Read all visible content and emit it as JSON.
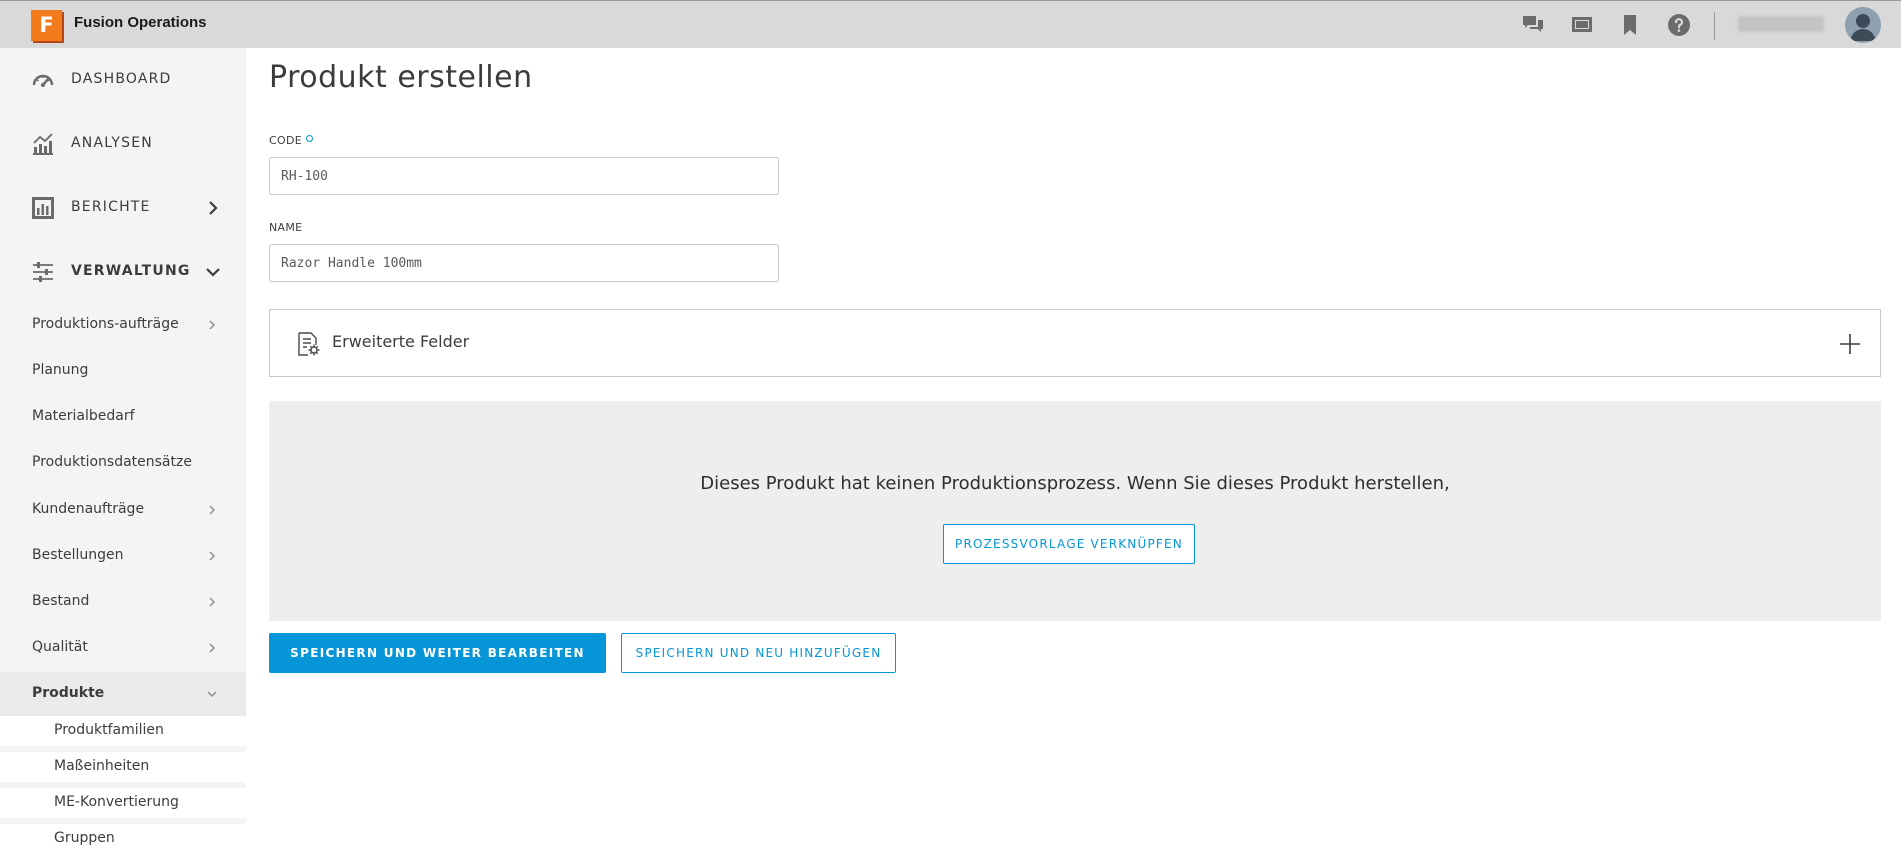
{
  "app": {
    "logo_letter": "F",
    "title": "Fusion Operations"
  },
  "topbar_icons": [
    "chat-icon",
    "screen-icon",
    "bookmark-icon",
    "help-icon"
  ],
  "sidebar": {
    "main": [
      {
        "label": "DASHBOARD",
        "icon": "dashboard-gauge-icon"
      },
      {
        "label": "ANALYSEN",
        "icon": "analytics-chart-icon"
      },
      {
        "label": "BERICHTE",
        "icon": "reports-bar-icon",
        "chevron": "right"
      },
      {
        "label": "VERWALTUNG",
        "icon": "settings-sliders-icon",
        "chevron": "down"
      }
    ],
    "sub": [
      {
        "label": "Produktions-aufträge",
        "chevron": true
      },
      {
        "label": "Planung",
        "chevron": false
      },
      {
        "label": "Materialbedarf",
        "chevron": false
      },
      {
        "label": "Produktionsdatensätze",
        "chevron": false
      },
      {
        "label": "Kundenaufträge",
        "chevron": true
      },
      {
        "label": "Bestellungen",
        "chevron": true
      },
      {
        "label": "Bestand",
        "chevron": true
      },
      {
        "label": "Qualität",
        "chevron": true
      },
      {
        "label": "Produkte",
        "chevron": true
      }
    ],
    "leaf": [
      {
        "label": "Produktfamilien"
      },
      {
        "label": "Maßeinheiten"
      },
      {
        "label": "ME-Konvertierung"
      },
      {
        "label": "Gruppen"
      }
    ]
  },
  "page": {
    "title": "Produkt erstellen",
    "code": {
      "label": "CODE",
      "value": "RH-100"
    },
    "name": {
      "label": "NAME",
      "value": "Razor Handle 100mm"
    },
    "advanced_fields": "Erweiterte Felder",
    "no_process_msg": "Dieses Produkt hat keinen Produktionsprozess. Wenn Sie dieses Produkt herstellen,",
    "link_template_btn": "PROZESSVORLAGE VERKNÜPFEN",
    "save_edit_btn": "SPEICHERN UND WEITER BEARBEITEN",
    "save_new_btn": "SPEICHERN UND NEU HINZUFÜGEN"
  },
  "colors": {
    "accent": "#0696d7",
    "logo": "#f27b1e",
    "topbar": "#d9d9d9",
    "sidebar": "#f4f4f4"
  }
}
